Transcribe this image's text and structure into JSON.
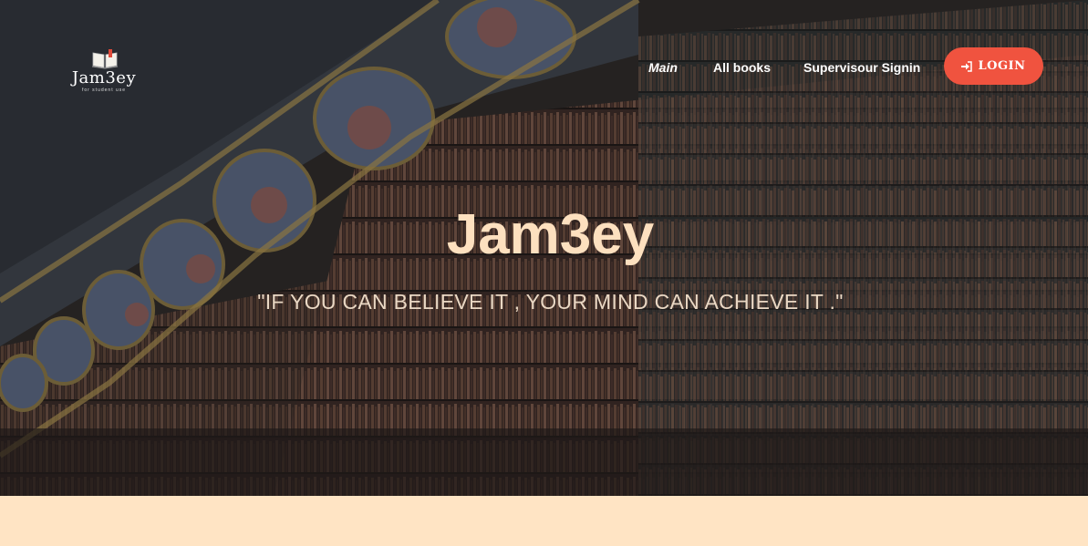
{
  "brand": {
    "name": "Jam3ey",
    "tagline": "for student use",
    "logo_icon": "open-book-icon"
  },
  "nav": {
    "items": [
      {
        "label": "Main",
        "active": true
      },
      {
        "label": "All books"
      },
      {
        "label": "Supervisour Signin"
      }
    ],
    "login": {
      "label": "LOGIN",
      "icon": "sign-in-icon"
    }
  },
  "hero": {
    "title": "Jam3ey",
    "quote": "\"IF YOU CAN BELIEVE IT , YOUR MIND CAN ACHIEVE IT .\""
  },
  "colors": {
    "accent": "#f0533f",
    "title": "#fde0bf",
    "band": "#ffe4c4"
  }
}
